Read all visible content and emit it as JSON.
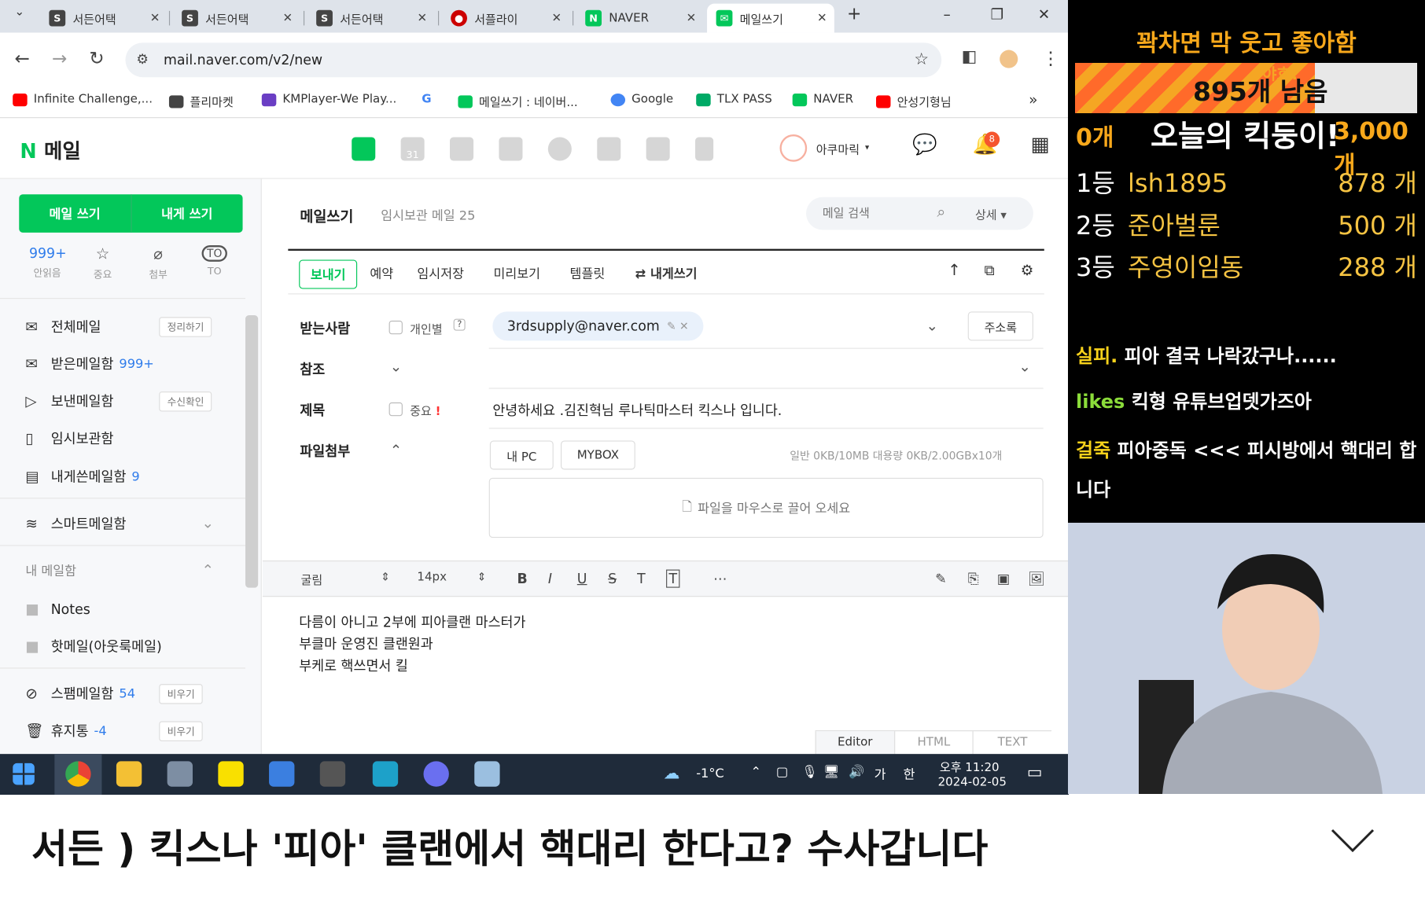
{
  "tabs": [
    {
      "label": "서든어택"
    },
    {
      "label": "서든어택"
    },
    {
      "label": "서든어택"
    },
    {
      "label": "서플라이"
    },
    {
      "label": "NAVER"
    },
    {
      "label": "메일쓰기"
    }
  ],
  "address": {
    "url": "mail.naver.com/v2/new"
  },
  "bookmarks": [
    {
      "label": "Infinite Challenge,..."
    },
    {
      "label": "플리마켓"
    },
    {
      "label": "KMPlayer-We Play..."
    },
    {
      "label": "G"
    },
    {
      "label": "메일쓰기 : 네이버..."
    },
    {
      "label": "Google"
    },
    {
      "label": "TLX PASS"
    },
    {
      "label": "NAVER"
    },
    {
      "label": "안성기형님"
    },
    {
      "label": "»"
    }
  ],
  "naver": {
    "logo": "N",
    "logo_text": "메일",
    "calendar_day": "31",
    "profile_name": "아쿠마릭",
    "notification_count": "8"
  },
  "sidebar": {
    "write_mail": "메일 쓰기",
    "write_self": "내게 쓰기",
    "quick": [
      {
        "value": "999+",
        "label": "안읽음"
      },
      {
        "label": "중요"
      },
      {
        "label": "첨부"
      },
      {
        "label": "TO"
      }
    ],
    "folders": [
      {
        "label": "전체메일",
        "pill": "정리하기"
      },
      {
        "label": "받은메일함",
        "count": "999+"
      },
      {
        "label": "보낸메일함",
        "pill": "수신확인"
      },
      {
        "label": "임시보관함"
      },
      {
        "label": "내게쓴메일함",
        "count": "9"
      },
      {
        "label": "스마트메일함"
      }
    ],
    "my_mailbox": "내 메일함",
    "my_folders": [
      {
        "label": "Notes"
      },
      {
        "label": "핫메일(아웃룩메일)"
      }
    ],
    "spam": {
      "label": "스팸메일함",
      "count": "54",
      "pill": "비우기"
    },
    "trash": {
      "label": "휴지통",
      "count": "-4",
      "pill": "비우기"
    }
  },
  "compose": {
    "title": "메일쓰기",
    "subtitle": "임시보관 메일 25",
    "search_placeholder": "메일 검색",
    "detail": "상세 ▾",
    "toolbar": {
      "send": "보내기",
      "reserve": "예약",
      "save": "임시저장",
      "preview": "미리보기",
      "template": "템플릿",
      "self": "⇄ 내게쓰기"
    },
    "to_label": "받는사람",
    "individual": "개인별",
    "recipient": "3rdsupply@naver.com",
    "address_book": "주소록",
    "cc_label": "참조",
    "subject_label": "제목",
    "important": "중요",
    "important_mark": "!",
    "subject": "안녕하세요 .김진혁님  루나틱마스터 킥스나 입니다.",
    "attach_label": "파일첨부",
    "my_pc": "내 PC",
    "mybox": "MYBOX",
    "quota": "일반 0KB/10MB  대용량 0KB/2.00GBx10개",
    "dropzone": "파일을 마우스로 끌어 오세요",
    "font": "굴림",
    "size": "14px",
    "body": [
      "다름이 아니고 2부에 피아클랜 마스터가",
      "부클마 운영진 클랜원과",
      "부케로 핵쓰면서 킬"
    ],
    "modes": [
      "Editor",
      "HTML",
      "TEXT"
    ]
  },
  "taskbar": {
    "weather": "-1°C",
    "ime": "가",
    "ime2": "한",
    "time": "오후 11:20",
    "date": "2024-02-05"
  },
  "overlay": {
    "title": "꽉차면 막 웃고 좋아함",
    "progress_value": 895,
    "progress_text": "895개 남음",
    "progress_sticker": "야호!",
    "left_count": "0개",
    "goal_title": "오늘의 킥둥이!",
    "goal_count": "3,000개",
    "progress_fraction": 0.7,
    "ranks": [
      {
        "rank": "1등",
        "name": "lsh1895",
        "count": "878 개"
      },
      {
        "rank": "2등",
        "name": "준아벌룬",
        "count": "500 개"
      },
      {
        "rank": "3등",
        "name": "주영이임동",
        "count": "288 개"
      }
    ],
    "chat": [
      {
        "user": "실피.",
        "msg": "피아 결국 나락갔구나......"
      },
      {
        "user": "likes",
        "msg": "킥형 유튜브업뎃가즈아"
      },
      {
        "user": "걸죽",
        "msg": "피아중독 <<< 피시방에서 핵대리 합니다"
      }
    ]
  },
  "video": {
    "title": "서든 ) 킥스나  '피아' 클랜에서 핵대리 한다고? 수사갑니다"
  },
  "colors": {
    "naver_green": "#03c75a",
    "overlay_gold": "#f5c342",
    "overlay_orange": "#f8a81b"
  }
}
